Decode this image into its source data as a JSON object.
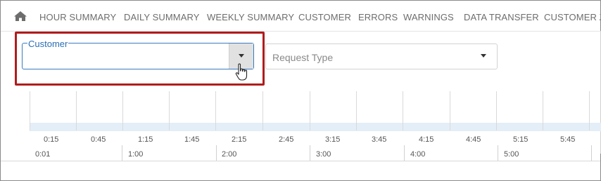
{
  "nav": {
    "tabs": [
      {
        "label": "HOUR SUMMARY"
      },
      {
        "label": "DAILY SUMMARY"
      },
      {
        "label": "WEEKLY SUMMARY"
      },
      {
        "label": "CUSTOMER"
      },
      {
        "label": "ERRORS"
      },
      {
        "label": "WARNINGS"
      },
      {
        "label": "DATA TRANSFER"
      },
      {
        "label": "CUSTOMER ZO"
      }
    ]
  },
  "filters": {
    "customer_label": "Customer",
    "customer_value": "",
    "request_type_placeholder": "Request Type"
  },
  "timeline": {
    "top_labels": [
      "0:15",
      "0:45",
      "1:15",
      "1:45",
      "2:15",
      "2:45",
      "3:15",
      "3:45",
      "4:15",
      "4:45",
      "5:15",
      "5:45"
    ],
    "bottom_labels": [
      "0:01",
      "1:00",
      "2:00",
      "3:00",
      "4:00",
      "5:00"
    ]
  },
  "colors": {
    "highlight": "#b01c1c",
    "focus": "#3a7bbf",
    "timeline_fill": "#e4eef8"
  },
  "icons": {
    "home": "home-icon",
    "dropdown": "caret-down-icon",
    "cursor": "hand-pointer-icon"
  }
}
